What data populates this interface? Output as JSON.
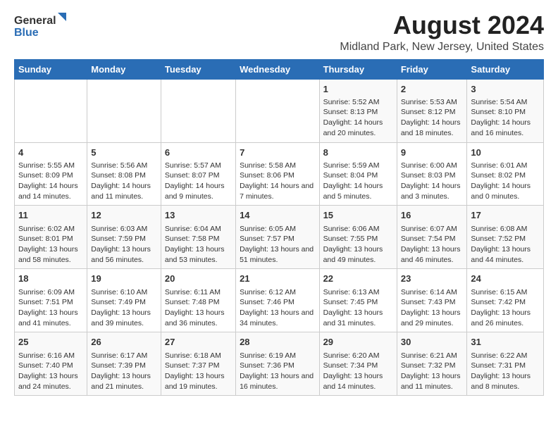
{
  "logo": {
    "general": "General",
    "blue": "Blue"
  },
  "title": "August 2024",
  "subtitle": "Midland Park, New Jersey, United States",
  "weekdays": [
    "Sunday",
    "Monday",
    "Tuesday",
    "Wednesday",
    "Thursday",
    "Friday",
    "Saturday"
  ],
  "weeks": [
    [
      {
        "day": "",
        "info": ""
      },
      {
        "day": "",
        "info": ""
      },
      {
        "day": "",
        "info": ""
      },
      {
        "day": "",
        "info": ""
      },
      {
        "day": "1",
        "info": "Sunrise: 5:52 AM\nSunset: 8:13 PM\nDaylight: 14 hours and 20 minutes."
      },
      {
        "day": "2",
        "info": "Sunrise: 5:53 AM\nSunset: 8:12 PM\nDaylight: 14 hours and 18 minutes."
      },
      {
        "day": "3",
        "info": "Sunrise: 5:54 AM\nSunset: 8:10 PM\nDaylight: 14 hours and 16 minutes."
      }
    ],
    [
      {
        "day": "4",
        "info": "Sunrise: 5:55 AM\nSunset: 8:09 PM\nDaylight: 14 hours and 14 minutes."
      },
      {
        "day": "5",
        "info": "Sunrise: 5:56 AM\nSunset: 8:08 PM\nDaylight: 14 hours and 11 minutes."
      },
      {
        "day": "6",
        "info": "Sunrise: 5:57 AM\nSunset: 8:07 PM\nDaylight: 14 hours and 9 minutes."
      },
      {
        "day": "7",
        "info": "Sunrise: 5:58 AM\nSunset: 8:06 PM\nDaylight: 14 hours and 7 minutes."
      },
      {
        "day": "8",
        "info": "Sunrise: 5:59 AM\nSunset: 8:04 PM\nDaylight: 14 hours and 5 minutes."
      },
      {
        "day": "9",
        "info": "Sunrise: 6:00 AM\nSunset: 8:03 PM\nDaylight: 14 hours and 3 minutes."
      },
      {
        "day": "10",
        "info": "Sunrise: 6:01 AM\nSunset: 8:02 PM\nDaylight: 14 hours and 0 minutes."
      }
    ],
    [
      {
        "day": "11",
        "info": "Sunrise: 6:02 AM\nSunset: 8:01 PM\nDaylight: 13 hours and 58 minutes."
      },
      {
        "day": "12",
        "info": "Sunrise: 6:03 AM\nSunset: 7:59 PM\nDaylight: 13 hours and 56 minutes."
      },
      {
        "day": "13",
        "info": "Sunrise: 6:04 AM\nSunset: 7:58 PM\nDaylight: 13 hours and 53 minutes."
      },
      {
        "day": "14",
        "info": "Sunrise: 6:05 AM\nSunset: 7:57 PM\nDaylight: 13 hours and 51 minutes."
      },
      {
        "day": "15",
        "info": "Sunrise: 6:06 AM\nSunset: 7:55 PM\nDaylight: 13 hours and 49 minutes."
      },
      {
        "day": "16",
        "info": "Sunrise: 6:07 AM\nSunset: 7:54 PM\nDaylight: 13 hours and 46 minutes."
      },
      {
        "day": "17",
        "info": "Sunrise: 6:08 AM\nSunset: 7:52 PM\nDaylight: 13 hours and 44 minutes."
      }
    ],
    [
      {
        "day": "18",
        "info": "Sunrise: 6:09 AM\nSunset: 7:51 PM\nDaylight: 13 hours and 41 minutes."
      },
      {
        "day": "19",
        "info": "Sunrise: 6:10 AM\nSunset: 7:49 PM\nDaylight: 13 hours and 39 minutes."
      },
      {
        "day": "20",
        "info": "Sunrise: 6:11 AM\nSunset: 7:48 PM\nDaylight: 13 hours and 36 minutes."
      },
      {
        "day": "21",
        "info": "Sunrise: 6:12 AM\nSunset: 7:46 PM\nDaylight: 13 hours and 34 minutes."
      },
      {
        "day": "22",
        "info": "Sunrise: 6:13 AM\nSunset: 7:45 PM\nDaylight: 13 hours and 31 minutes."
      },
      {
        "day": "23",
        "info": "Sunrise: 6:14 AM\nSunset: 7:43 PM\nDaylight: 13 hours and 29 minutes."
      },
      {
        "day": "24",
        "info": "Sunrise: 6:15 AM\nSunset: 7:42 PM\nDaylight: 13 hours and 26 minutes."
      }
    ],
    [
      {
        "day": "25",
        "info": "Sunrise: 6:16 AM\nSunset: 7:40 PM\nDaylight: 13 hours and 24 minutes."
      },
      {
        "day": "26",
        "info": "Sunrise: 6:17 AM\nSunset: 7:39 PM\nDaylight: 13 hours and 21 minutes."
      },
      {
        "day": "27",
        "info": "Sunrise: 6:18 AM\nSunset: 7:37 PM\nDaylight: 13 hours and 19 minutes."
      },
      {
        "day": "28",
        "info": "Sunrise: 6:19 AM\nSunset: 7:36 PM\nDaylight: 13 hours and 16 minutes."
      },
      {
        "day": "29",
        "info": "Sunrise: 6:20 AM\nSunset: 7:34 PM\nDaylight: 13 hours and 14 minutes."
      },
      {
        "day": "30",
        "info": "Sunrise: 6:21 AM\nSunset: 7:32 PM\nDaylight: 13 hours and 11 minutes."
      },
      {
        "day": "31",
        "info": "Sunrise: 6:22 AM\nSunset: 7:31 PM\nDaylight: 13 hours and 8 minutes."
      }
    ]
  ]
}
